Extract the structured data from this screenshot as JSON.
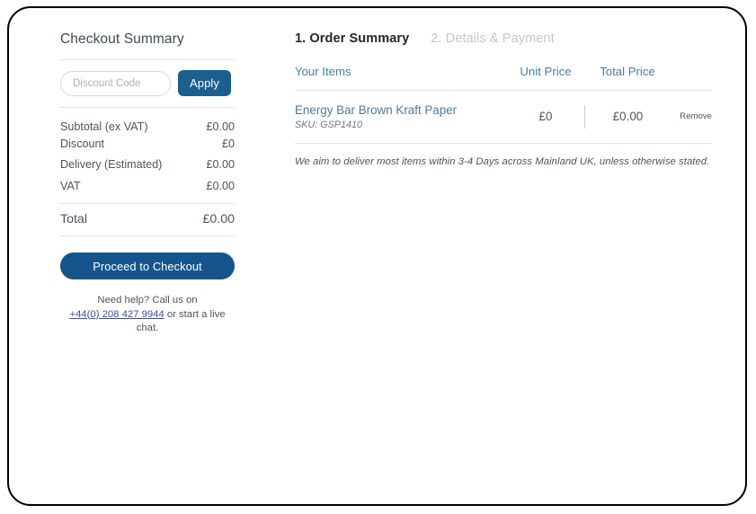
{
  "summary": {
    "title": "Checkout Summary",
    "discount_input": {
      "placeholder": "Discount Code",
      "value": ""
    },
    "apply_label": "Apply",
    "lines": [
      {
        "label": "Subtotal (ex VAT)",
        "amount": "£0.00"
      },
      {
        "label": "Discount",
        "amount": "£0"
      },
      {
        "label": "Delivery (Estimated)",
        "amount": "£0.00"
      },
      {
        "label": "VAT",
        "amount": "£0.00"
      }
    ],
    "total": {
      "label": "Total",
      "amount": "£0.00"
    },
    "proceed_label": "Proceed to Checkout",
    "help": {
      "lead": "Need help? Call us on",
      "phone": "+44(0) 208 427 9944",
      "tail": " or start a live chat."
    }
  },
  "order": {
    "steps": [
      {
        "label": "1. Order Summary",
        "state": "active"
      },
      {
        "label": "2. Details & Payment",
        "state": "inactive"
      }
    ],
    "columns": {
      "items": "Your Items",
      "unit_price": "Unit Price",
      "total_price": "Total Price"
    },
    "items": [
      {
        "name": "Energy Bar Brown Kraft Paper",
        "sku": "SKU: GSP1410",
        "unit_price": "£0",
        "total_price": "£0.00",
        "remove_label": "Remove"
      }
    ],
    "delivery_note": "We aim to deliver most items within 3-4 Days across Mainland UK, unless otherwise stated."
  },
  "colors": {
    "accent_blue": "#1b5e8f",
    "button_blue": "#15558c",
    "link_blue": "#4a7ba7",
    "phone_link": "#3c4ea8",
    "text": "#4b5560",
    "muted": "#c3c7cb",
    "rule": "#e2e4e6"
  }
}
